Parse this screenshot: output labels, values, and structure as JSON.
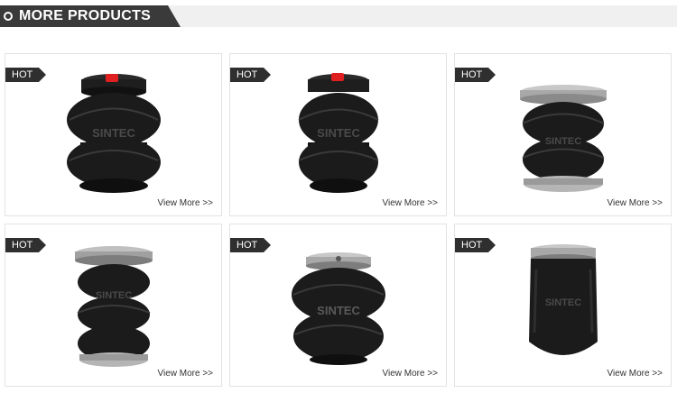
{
  "header": {
    "title": "MORE PRODUCTS"
  },
  "products": [
    {
      "badge": "HOT",
      "link": "View More >>",
      "brand": "SINTEC"
    },
    {
      "badge": "HOT",
      "link": "View More >>",
      "brand": "SINTEC"
    },
    {
      "badge": "HOT",
      "link": "View More >>",
      "brand": "SINTEC"
    },
    {
      "badge": "HOT",
      "link": "View More >>",
      "brand": "SINTEC"
    },
    {
      "badge": "HOT",
      "link": "View More >>",
      "brand": "SINTEC"
    },
    {
      "badge": "HOT",
      "link": "View More >>",
      "brand": "SINTEC"
    }
  ]
}
